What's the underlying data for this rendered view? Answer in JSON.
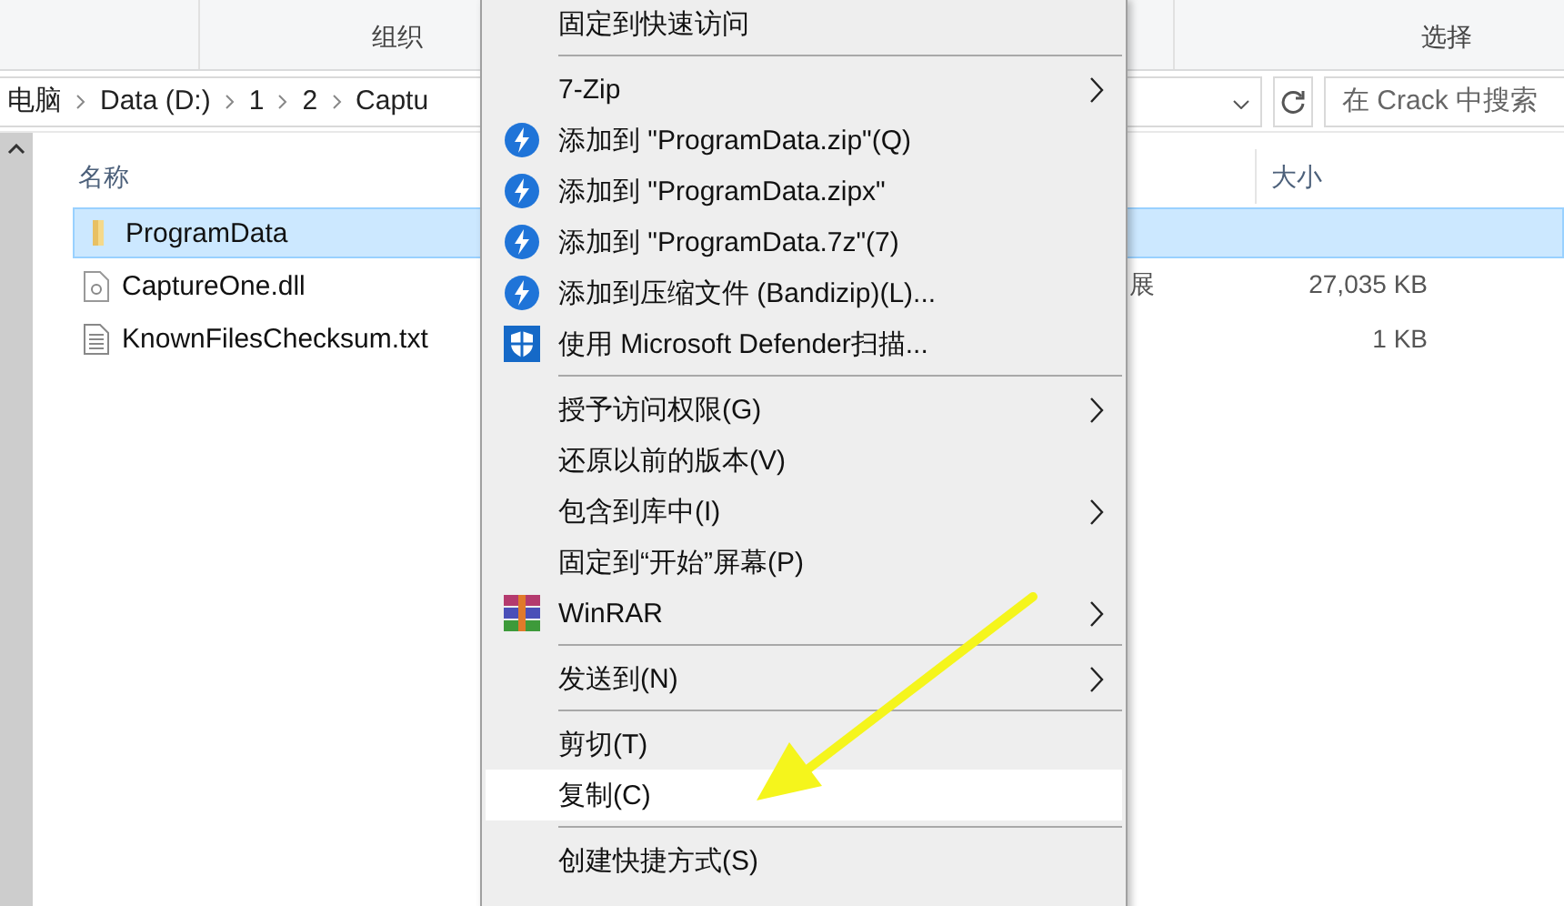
{
  "ribbon": {
    "groups": [
      "组织",
      "选择"
    ]
  },
  "address_bar": {
    "crumbs": [
      "电脑",
      "Data (D:)",
      "1",
      "2",
      "Captu"
    ]
  },
  "search": {
    "placeholder": "在 Crack 中搜索"
  },
  "columns": [
    "名称",
    "大小"
  ],
  "files": [
    {
      "name": "ProgramData",
      "kind": "folder",
      "selected": true
    },
    {
      "name": "CaptureOne.dll",
      "kind": "dll",
      "type_partial": "展",
      "size": "27,035 KB",
      "selected": false
    },
    {
      "name": "KnownFilesChecksum.txt",
      "kind": "text",
      "size": "1 KB",
      "selected": false
    }
  ],
  "context_menu": [
    {
      "kind": "plain",
      "label": "固定到快速访问",
      "submenu": false,
      "selected": false
    },
    {
      "kind": "separator"
    },
    {
      "kind": "plain",
      "label": "7-Zip",
      "submenu": true,
      "selected": false
    },
    {
      "kind": "bandizip",
      "label": "添加到 \"ProgramData.zip\"(Q)",
      "submenu": false,
      "selected": false
    },
    {
      "kind": "bandizip",
      "label": "添加到 \"ProgramData.zipx\"",
      "submenu": false,
      "selected": false
    },
    {
      "kind": "bandizip",
      "label": "添加到 \"ProgramData.7z\"(7)",
      "submenu": false,
      "selected": false
    },
    {
      "kind": "bandizip",
      "label": "添加到压缩文件 (Bandizip)(L)...",
      "submenu": false,
      "selected": false
    },
    {
      "kind": "defender",
      "label": "使用 Microsoft Defender扫描...",
      "submenu": false,
      "selected": false
    },
    {
      "kind": "separator"
    },
    {
      "kind": "plain",
      "label": "授予访问权限(G)",
      "submenu": true,
      "selected": false
    },
    {
      "kind": "plain",
      "label": "还原以前的版本(V)",
      "submenu": false,
      "selected": false
    },
    {
      "kind": "plain",
      "label": "包含到库中(I)",
      "submenu": true,
      "selected": false
    },
    {
      "kind": "plain",
      "label": "固定到“开始”屏幕(P)",
      "submenu": false,
      "selected": false
    },
    {
      "kind": "winrar",
      "label": "WinRAR",
      "submenu": true,
      "selected": false
    },
    {
      "kind": "separator"
    },
    {
      "kind": "plain",
      "label": "发送到(N)",
      "submenu": true,
      "selected": false
    },
    {
      "kind": "separator"
    },
    {
      "kind": "plain",
      "label": "剪切(T)",
      "submenu": false,
      "selected": false
    },
    {
      "kind": "plain",
      "label": "复制(C)",
      "submenu": false,
      "selected": true
    },
    {
      "kind": "separator"
    },
    {
      "kind": "plain",
      "label": "创建快捷方式(S)",
      "submenu": false,
      "selected": false
    }
  ],
  "annotation": {
    "kind": "arrow"
  }
}
